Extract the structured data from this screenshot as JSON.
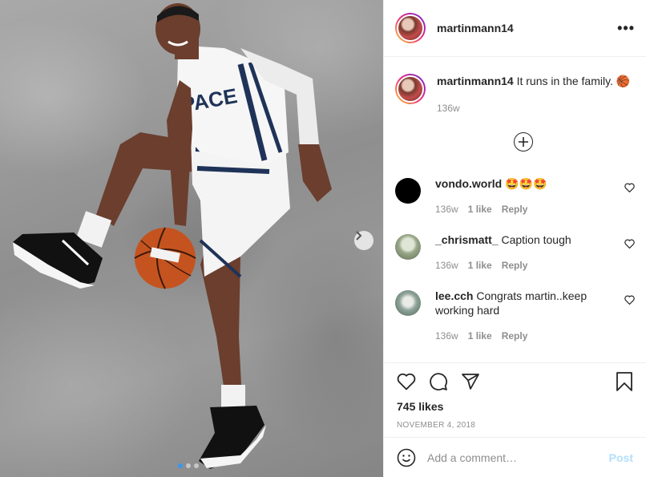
{
  "post": {
    "username": "martinmann14",
    "more_icon": "more-horizontal-icon"
  },
  "caption": {
    "username": "martinmann14",
    "text": "It runs in the family.",
    "emoji": "🏀",
    "age": "136w"
  },
  "comments": [
    {
      "username": "vondo.world",
      "text": "🤩🤩🤩",
      "age": "136w",
      "likes": "1 like",
      "reply": "Reply"
    },
    {
      "username": "_chrismatt_",
      "text": "Caption tough",
      "age": "136w",
      "likes": "1 like",
      "reply": "Reply"
    },
    {
      "username": "lee.cch",
      "text": "Congrats martin..keep working hard",
      "age": "136w",
      "likes": "1 like",
      "reply": "Reply"
    }
  ],
  "actions": {
    "likes": "745 likes",
    "date": "November 4, 2018"
  },
  "comment_box": {
    "placeholder": "Add a comment…",
    "post_label": "Post"
  },
  "carousel": {
    "dots": 3,
    "active_index": 0
  },
  "colors": {
    "accent": "#3897f0",
    "post_disabled": "#b2dffc",
    "muted": "#8e8e8e"
  }
}
